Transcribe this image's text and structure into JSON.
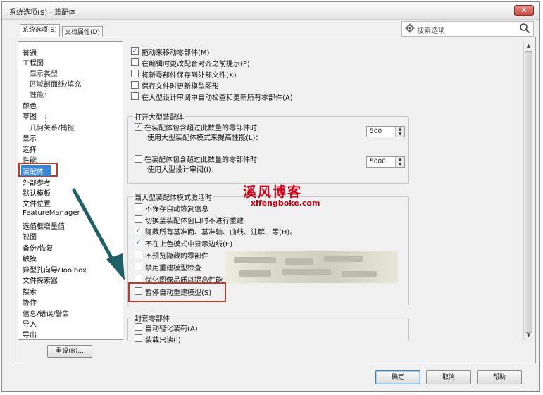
{
  "window": {
    "title": "系统选项(S) - 装配体",
    "close": "✕"
  },
  "tabs": [
    {
      "label": "系统选项(S)",
      "active": true
    },
    {
      "label": "文档属性(D)",
      "active": false
    }
  ],
  "search": {
    "placeholder": "搜索选项"
  },
  "tree": [
    "普通",
    "工程图",
    "显示类型",
    "区域剖面线/填充",
    "性能",
    "颜色",
    "草图",
    "几何关系/捕捉",
    "显示",
    "选择",
    "性能",
    "装配体",
    "外部参考",
    "默认模板",
    "文件位置",
    "FeatureManager",
    "选值框增量值",
    "视图",
    "备份/恢复",
    "触摸",
    "异型孔向导/Toolbox",
    "文件探索器",
    "搜索",
    "协作",
    "信息/错误/警告",
    "导入",
    "导出"
  ],
  "selected_item": "装配体",
  "reset_button": "重设(R)...",
  "options": [
    {
      "label": "拖动来移动零部件(M)",
      "checked": true
    },
    {
      "label": "在编辑时更改配合对齐之前提示(P)",
      "checked": false
    },
    {
      "label": "将新零部件保存到外部文件(X)",
      "checked": false
    },
    {
      "label": "保存文件时更新模型图形",
      "checked": false
    },
    {
      "label": "在大型设计审阅中自动检查和更新所有零部件(A)",
      "checked": false
    }
  ],
  "large_assembly_group": {
    "title": "打开大型装配体",
    "row1": {
      "line1": "在装配体包含超过此数量的零部件时",
      "line2": "使用大型装配体模式来提高性能(L)：",
      "value": "500",
      "checked": true
    },
    "row2": {
      "line1": "在装配体包含超过此数量的零部件时",
      "line2": "使用大型设计审阅(I)：",
      "value": "5000",
      "checked": false
    }
  },
  "large_mode_group": {
    "title": "当大型装配体模式激活时",
    "items": [
      {
        "label": "不保存自动恢复信息",
        "checked": false
      },
      {
        "label": "切换至装配体窗口时不进行重建",
        "checked": false
      },
      {
        "label": "隐藏所有基准面、基准轴、曲线、注解、等(H)。",
        "checked": true
      },
      {
        "label": "不在上色模式中显示边线(E)",
        "checked": true
      },
      {
        "label": "不预览隐藏的零部件",
        "checked": false
      },
      {
        "label": "禁用重建模型检查",
        "checked": false
      },
      {
        "label": "优化图像品质以提高性能",
        "checked": false
      },
      {
        "label": "暂停自动重建模型(S)",
        "checked": false
      }
    ]
  },
  "envelope_group": {
    "title": "封套零部件",
    "items": [
      {
        "label": "自动轻化装荷(A)",
        "checked": false
      },
      {
        "label": "装载只读(I)",
        "checked": false
      }
    ]
  },
  "buttons": {
    "ok": "确定",
    "cancel": "取消",
    "help": "帮助"
  },
  "watermark": {
    "title": "溪风博客",
    "url": "xifengboke.com"
  },
  "colors": {
    "highlight_box": "#c0392b",
    "selection": "#3a86d6",
    "arrow": "#1f5f66",
    "watermark": "#d0021b"
  }
}
